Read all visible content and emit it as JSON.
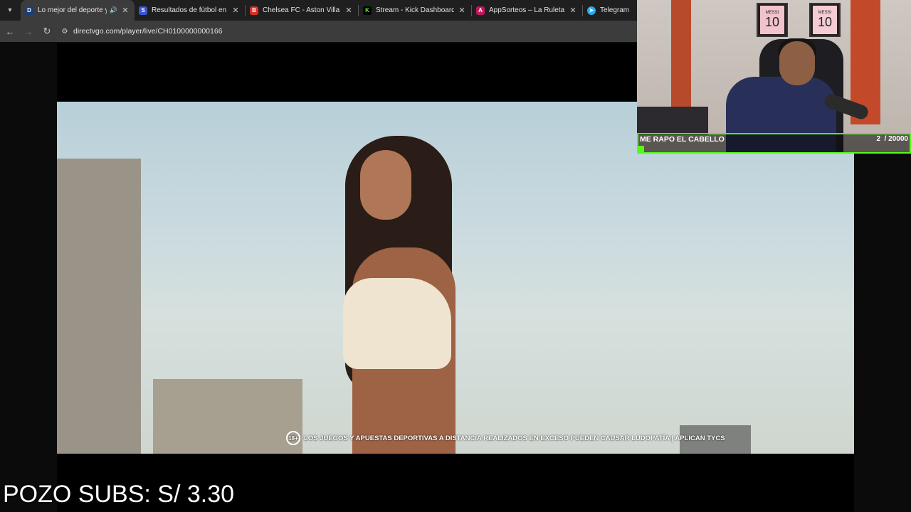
{
  "browser": {
    "tabs": [
      {
        "title": "Lo mejor del deporte y el e",
        "favicon": "directvgo-icon",
        "color": "#2e7dd7",
        "active": true,
        "audio": true
      },
      {
        "title": "Resultados de fútbol en directo",
        "favicon": "sofascore-icon",
        "color": "#3a56d6",
        "active": false
      },
      {
        "title": "Chelsea FC - Aston Villa Cuotas",
        "favicon": "betting-icon",
        "color": "#d93025",
        "active": false
      },
      {
        "title": "Stream - Kick Dashboard",
        "favicon": "kick-icon",
        "color": "#53fc18",
        "active": false
      },
      {
        "title": "AppSorteos – La Ruleta de la Su",
        "favicon": "appsorteos-icon",
        "color": "#c2185b",
        "active": false
      },
      {
        "title": "Telegram Web",
        "favicon": "telegram-icon",
        "color": "#2aabee",
        "active": false
      }
    ],
    "url": "directvgo.com/player/live/CH0100000000166"
  },
  "video": {
    "disclaimer_age": "18+",
    "disclaimer_text": "LOS JUEGOS Y APUESTAS DEPORTIVAS A DISTANCIA REALIZADOS EN EXCESO PUEDEN CAUSAR LUDOPATÍA | APLICAN TYCS"
  },
  "webcam": {
    "frame_left": {
      "name": "MESSI",
      "number": "10"
    },
    "frame_right": {
      "name": "MESSI",
      "number": "10"
    },
    "goal_title": "ME RAPO EL CABELLO",
    "goal_current": "2",
    "goal_target": "/ 20000",
    "goal_progress": 0.0001,
    "goal_color": "#53fc18"
  },
  "overlay": {
    "pozo": "POZO SUBS: S/ 3.30"
  }
}
